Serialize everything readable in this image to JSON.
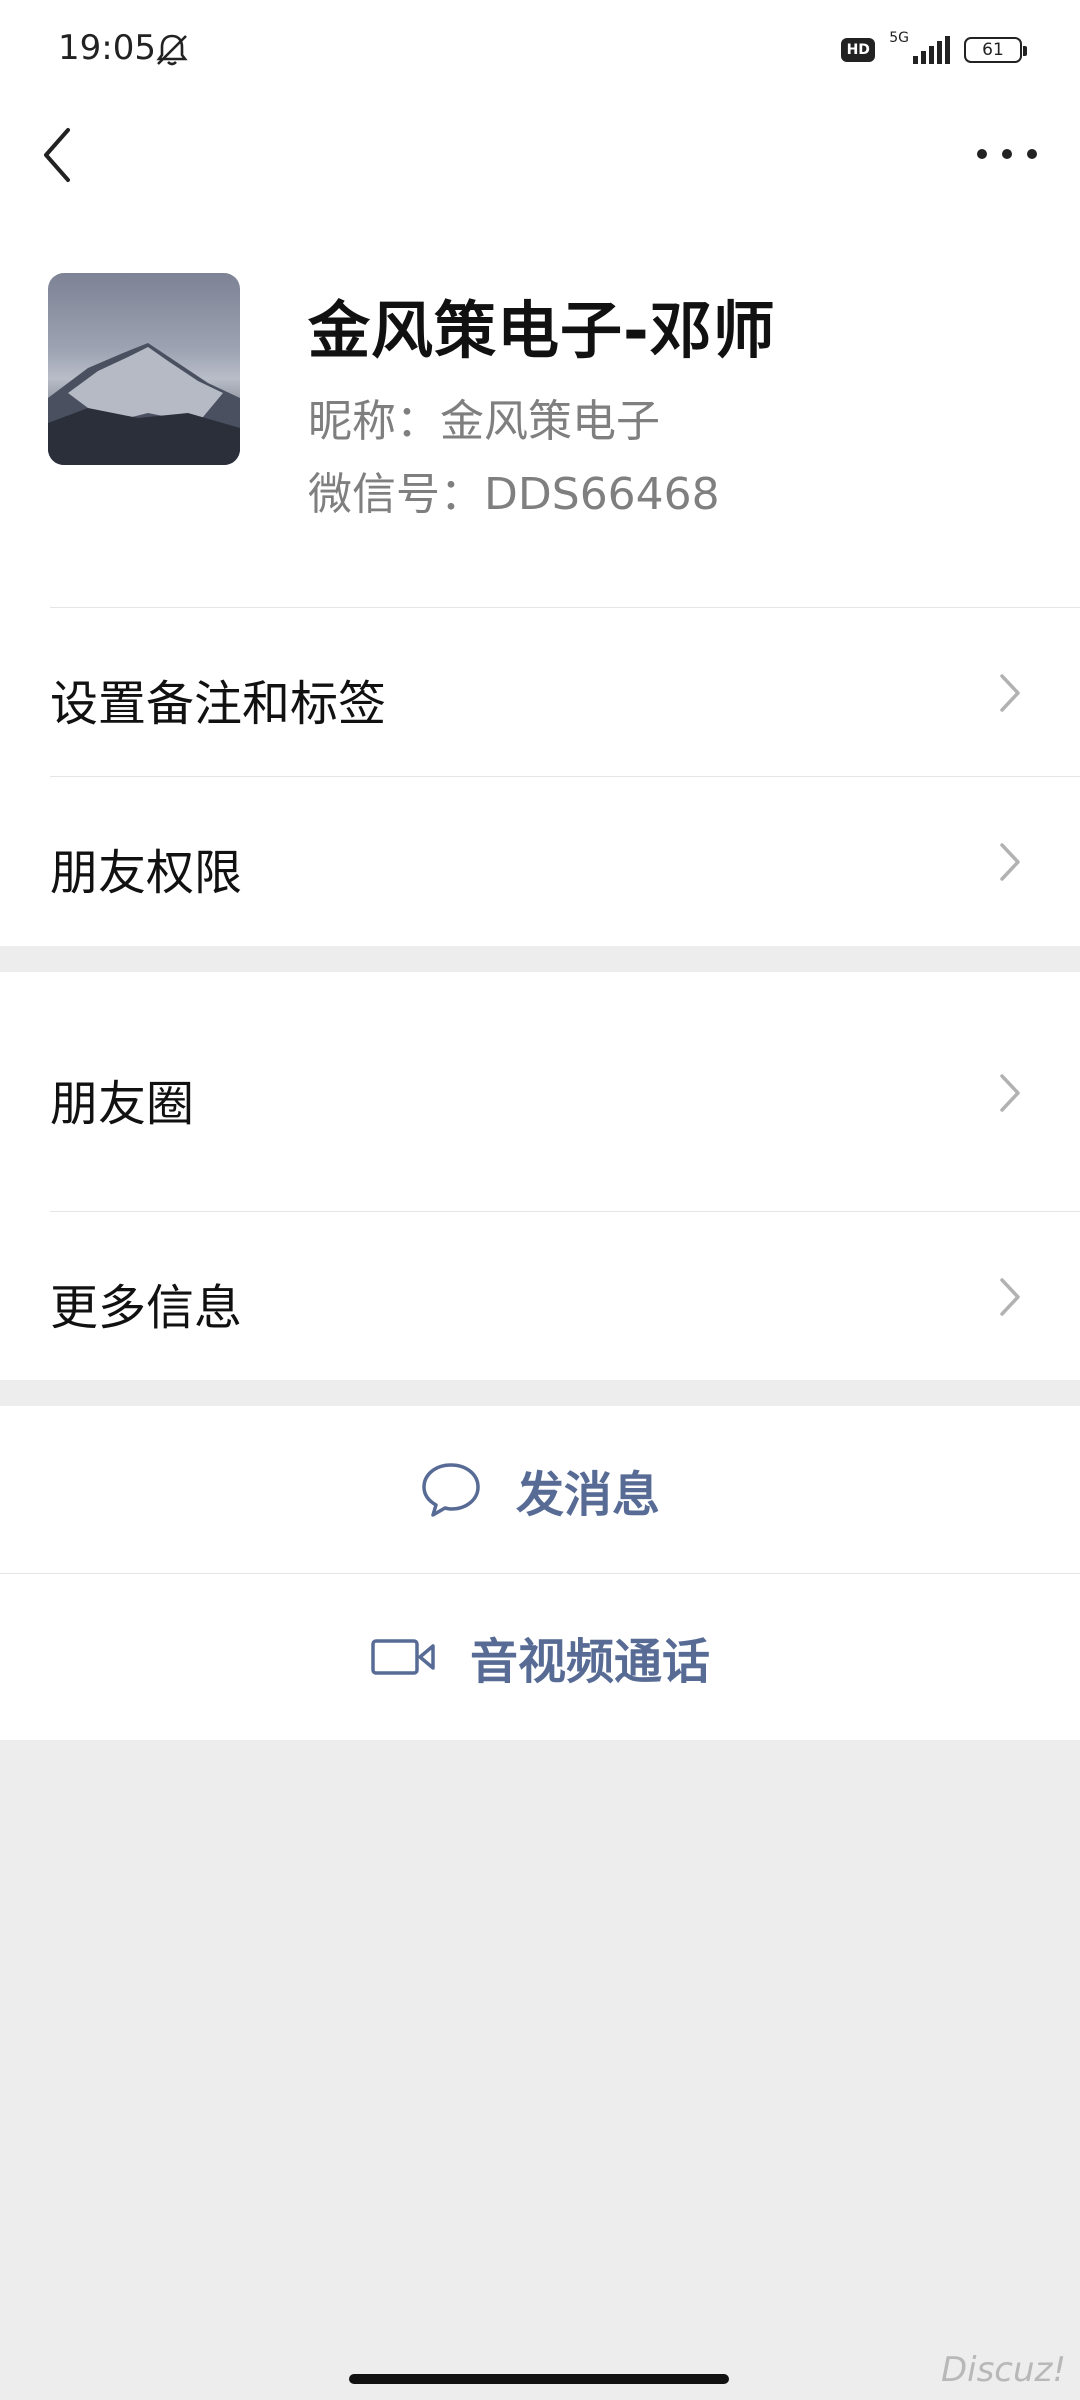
{
  "status_bar": {
    "time": "19:05",
    "hd": "HD",
    "network": "5G",
    "battery": "61",
    "icons": [
      "bell-off-icon",
      "signal-icon",
      "battery-icon"
    ]
  },
  "nav": {
    "back_icon": "back-chevron-icon",
    "more_icon": "more-dots-icon"
  },
  "profile": {
    "display_name": "金风策电子-邓师",
    "nickname": "昵称：金风策电子",
    "wechat_id": "微信号：DDS66468"
  },
  "menu_group_1": [
    {
      "label": "设置备注和标签"
    },
    {
      "label": "朋友权限"
    }
  ],
  "menu_group_2": [
    {
      "label": "朋友圈"
    },
    {
      "label": "更多信息"
    }
  ],
  "actions": {
    "message": {
      "label": "发消息",
      "icon": "chat-bubble-icon"
    },
    "call": {
      "label": "音视频通话",
      "icon": "video-camera-icon"
    }
  },
  "watermark": "Discuz!",
  "colors": {
    "accent": "#576b95",
    "background": "#ededed",
    "card": "#ffffff",
    "secondary_text": "#7f7f7f"
  }
}
